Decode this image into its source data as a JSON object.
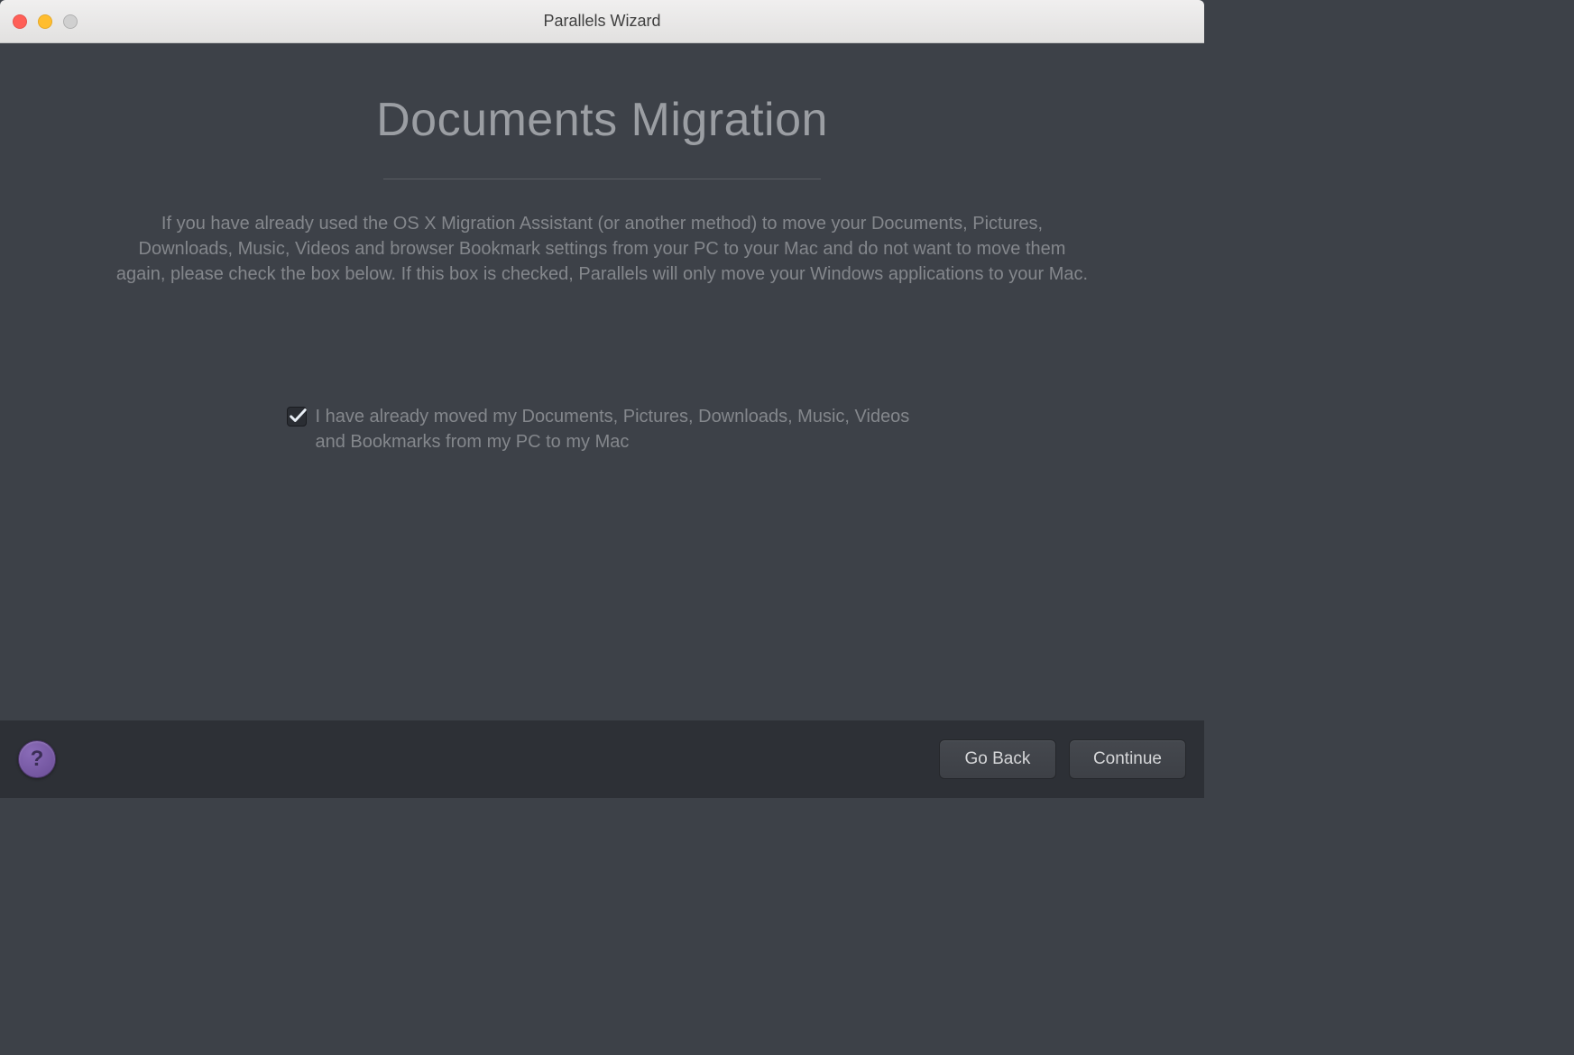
{
  "window": {
    "title": "Parallels Wizard"
  },
  "main": {
    "heading": "Documents Migration",
    "description": "If you have already used the OS X Migration Assistant (or another method) to move your Documents, Pictures, Downloads, Music, Videos and browser Bookmark settings from your PC to your Mac and do not want to move them again, please check the box below. If this box is checked, Parallels will only move your Windows applications to your Mac.",
    "checkbox": {
      "checked": true,
      "label": "I have already moved my Documents, Pictures, Downloads, Music, Videos and Bookmarks from my PC to my Mac"
    }
  },
  "footer": {
    "help_label": "?",
    "back_label": "Go Back",
    "continue_label": "Continue"
  }
}
